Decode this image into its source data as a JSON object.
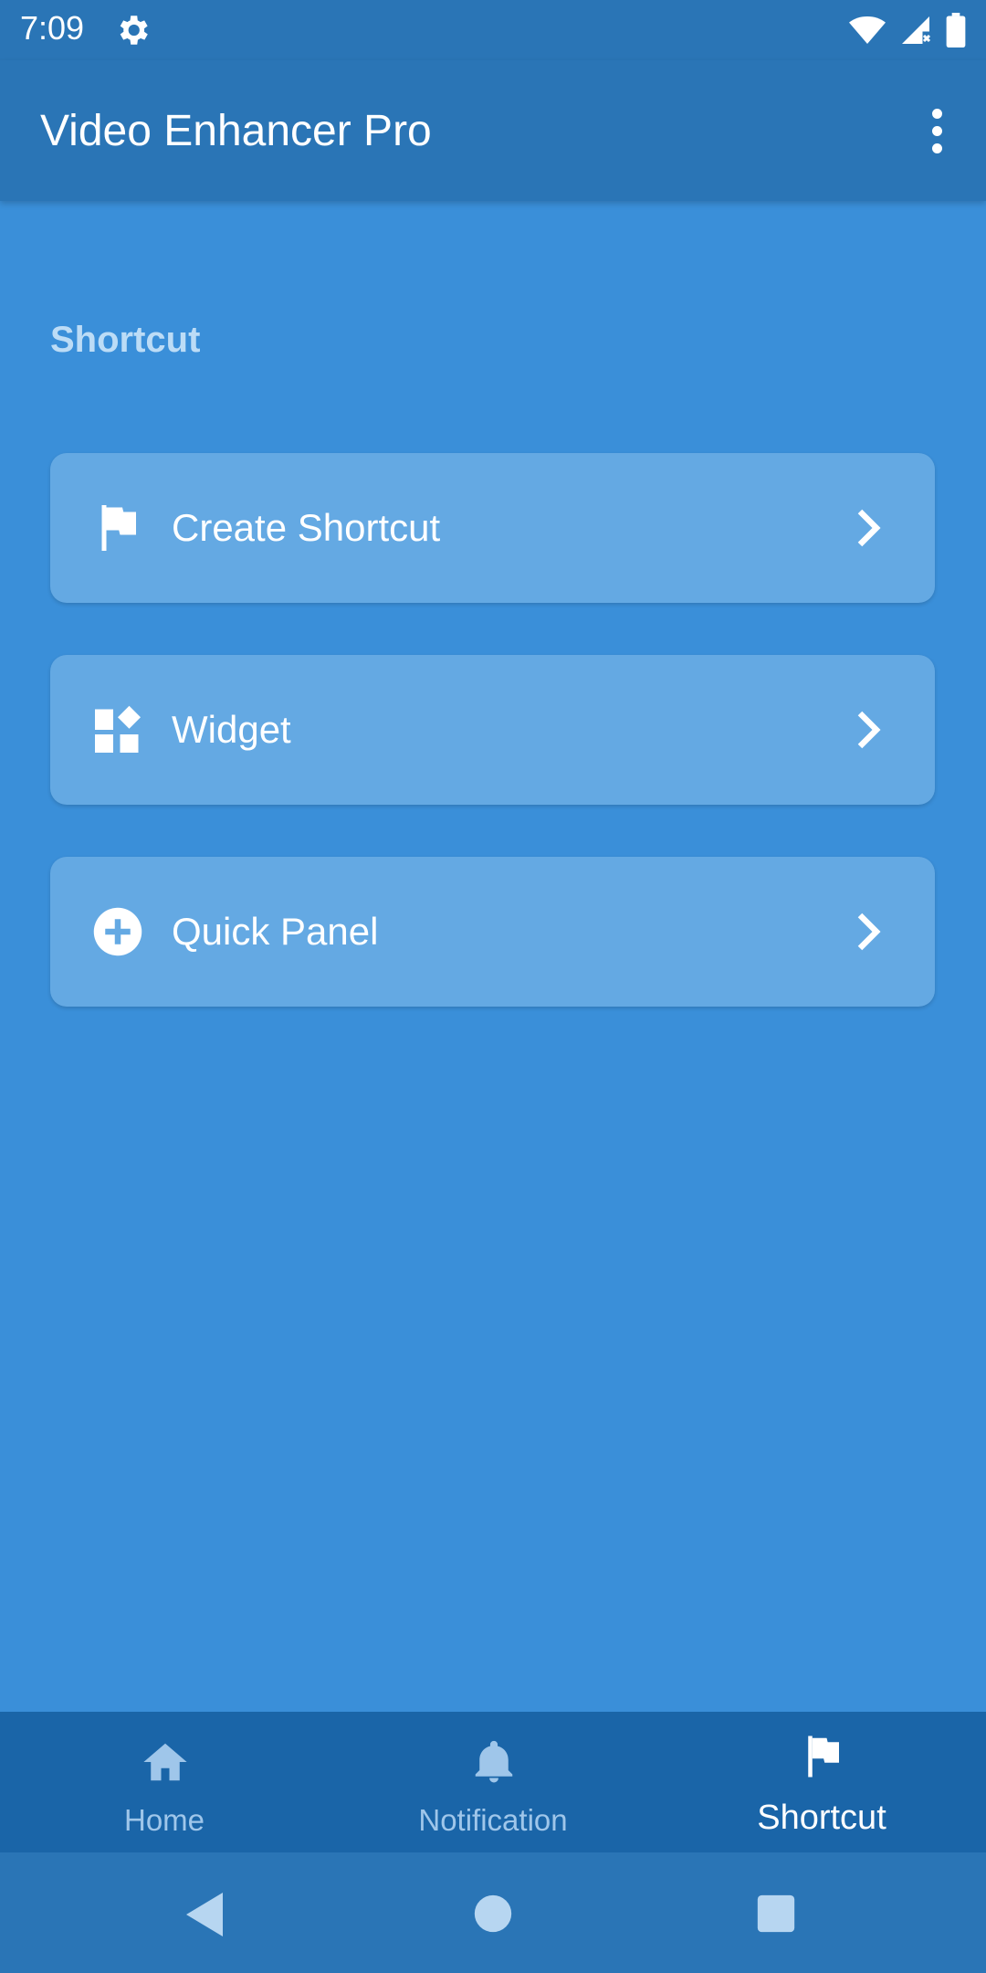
{
  "status_bar": {
    "time": "7:09",
    "icons": [
      "settings-gear-icon",
      "wifi-icon",
      "signal-icon",
      "battery-icon"
    ]
  },
  "app_bar": {
    "title": "Video Enhancer Pro",
    "overflow_icon": "more-vert-icon"
  },
  "section": {
    "title": "Shortcut"
  },
  "items": [
    {
      "label": "Create Shortcut",
      "icon": "flag-icon"
    },
    {
      "label": "Widget",
      "icon": "widgets-icon"
    },
    {
      "label": "Quick Panel",
      "icon": "add-circle-icon"
    }
  ],
  "bottom_nav": {
    "items": [
      {
        "label": "Home",
        "icon": "home-icon",
        "active": false
      },
      {
        "label": "Notification",
        "icon": "bell-icon",
        "active": false
      },
      {
        "label": "Shortcut",
        "icon": "flag-icon",
        "active": true
      }
    ]
  },
  "system_nav": [
    "back-icon",
    "home-circle-icon",
    "recents-square-icon"
  ],
  "colors": {
    "background": "#3a8fd9",
    "app_bar": "#2a75b6",
    "card": "#64a9e3",
    "section_title": "#bcdcf6",
    "bottom_nav": "#1a65a8",
    "nav_inactive": "#9fc6ea",
    "nav_active": "#ffffff"
  }
}
